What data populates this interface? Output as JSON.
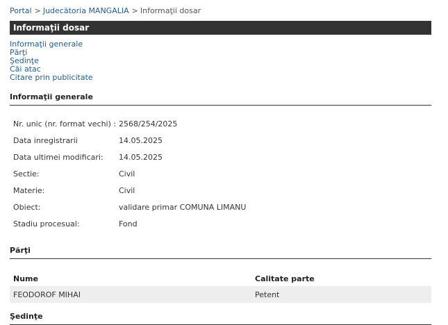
{
  "breadcrumb": {
    "items": [
      {
        "label": "Portal"
      },
      {
        "label": "Judecătoria MANGALIA"
      }
    ],
    "separator": ">",
    "current": "Informaţii dosar"
  },
  "title_bar": {
    "title": "Informaţii dosar"
  },
  "anchor_links": [
    {
      "label": "Informaţii generale"
    },
    {
      "label": "Părţi"
    },
    {
      "label": "Şedinţe"
    },
    {
      "label": "Căi atac"
    },
    {
      "label": "Citare prin publicitate"
    }
  ],
  "general_info": {
    "heading": "Informaţii generale",
    "rows": [
      {
        "label": "Nr. unic (nr. format vechi) :",
        "value": "2568/254/2025"
      },
      {
        "label": "Data inregistrarii",
        "value": "14.05.2025"
      },
      {
        "label": "Data ultimei modificari:",
        "value": "14.05.2025"
      },
      {
        "label": "Sectie:",
        "value": "Civil"
      },
      {
        "label": "Materie:",
        "value": "Civil"
      },
      {
        "label": "Obiect:",
        "value": "validare primar COMUNA LIMANU"
      },
      {
        "label": "Stadiu procesual:",
        "value": "Fond"
      }
    ]
  },
  "parties": {
    "heading": "Părţi",
    "columns": [
      "Nume",
      "Calitate parte"
    ],
    "rows": [
      {
        "name": "FEODOROF MIHAI",
        "role": "Petent"
      }
    ]
  },
  "hearings": {
    "heading": "Şedinţe"
  },
  "colors": {
    "link": "#1f5b94",
    "title_bar_bg": "#333333",
    "row_bg": "#eeeeee"
  }
}
